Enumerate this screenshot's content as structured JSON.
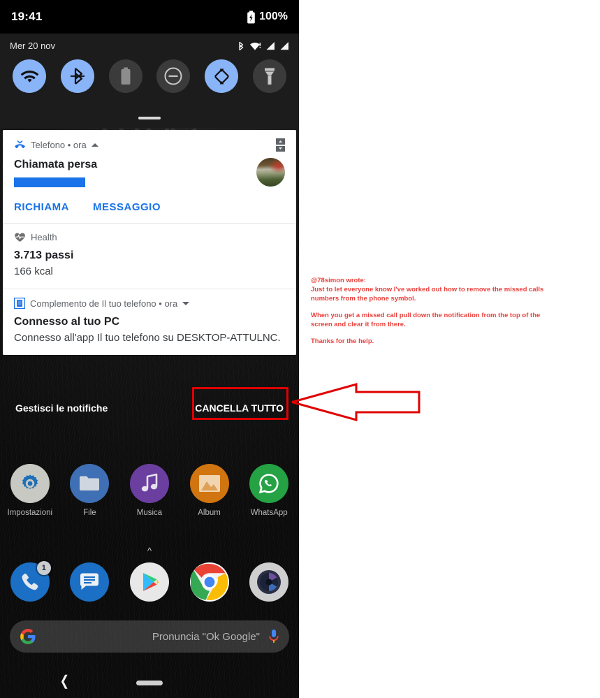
{
  "status_bar": {
    "time": "19:41",
    "battery_percent": "100%",
    "battery_icon": "battery-charging-icon"
  },
  "wallpaper_clock": "19:41",
  "quick_settings": {
    "date": "Mer 20 nov",
    "status_icons": [
      "bluetooth-icon",
      "wifi-icon",
      "signal-bars-icon",
      "signal-bars-2-icon"
    ],
    "tiles": [
      {
        "name": "wifi-tile",
        "icon": "wifi-icon",
        "state": "on"
      },
      {
        "name": "bluetooth-tile",
        "icon": "bluetooth-icon",
        "state": "on"
      },
      {
        "name": "battery-saver-tile",
        "icon": "battery-icon",
        "state": "off"
      },
      {
        "name": "do-not-disturb-tile",
        "icon": "do-not-disturb-icon",
        "state": "off"
      },
      {
        "name": "auto-rotate-tile",
        "icon": "auto-rotate-icon",
        "state": "on"
      },
      {
        "name": "flashlight-tile",
        "icon": "flashlight-icon",
        "state": "off"
      }
    ]
  },
  "notifications": [
    {
      "app": "Telefono • ora",
      "app_icon": "missed-call-icon",
      "expand_state": "expanded",
      "title": "Chiamata persa",
      "redacted_caller": true,
      "avatar": "contact-photo",
      "header_action_icon": "snooze-icon",
      "actions": [
        "RICHIAMA",
        "MESSAGGIO"
      ]
    },
    {
      "app": "Health",
      "app_icon": "heart-icon",
      "title": "3.713 passi",
      "subtitle": "166 kcal"
    },
    {
      "app": "Complemento de Il tuo telefono • ora",
      "app_icon": "your-phone-icon",
      "expand_state": "collapsed",
      "title": "Connesso al tuo PC",
      "subtitle": "Connesso all'app Il tuo telefono su DESKTOP-ATTULNC."
    }
  ],
  "shade_footer": {
    "manage_label": "Gestisci le notifiche",
    "clear_all_label": "CANCELLA TUTTO"
  },
  "home": {
    "apps": [
      {
        "label": "Impostazioni",
        "icon": "settings-gear-icon",
        "color": "#c9c9c4"
      },
      {
        "label": "File",
        "icon": "folder-icon",
        "color": "#3f6fb5"
      },
      {
        "label": "Musica",
        "icon": "music-note-icon",
        "color": "#6b3fa0"
      },
      {
        "label": "Album",
        "icon": "photo-icon",
        "color": "#d0750f"
      },
      {
        "label": "WhatsApp",
        "icon": "whatsapp-icon",
        "color": "#25a244"
      }
    ],
    "drawer_handle_icon": "chevron-up-icon",
    "dock": [
      {
        "name": "phone",
        "icon": "phone-icon",
        "badge": "1",
        "color": "#1b6fc4"
      },
      {
        "name": "messages",
        "icon": "messages-icon",
        "badge": "",
        "color": "#1b6fc4"
      },
      {
        "name": "play-store",
        "icon": "play-store-icon",
        "badge": "",
        "color": "#e8e8e8"
      },
      {
        "name": "chrome",
        "icon": "chrome-icon",
        "badge": "",
        "color": "#ffffff"
      },
      {
        "name": "camera",
        "icon": "camera-icon",
        "badge": "",
        "color": "#cfcfcf"
      }
    ],
    "search": {
      "logo_icon": "google-g-icon",
      "placeholder": "Pronuncia \"Ok Google\"",
      "mic_icon": "microphone-icon"
    },
    "nav": {
      "back_icon": "back-chevron-icon",
      "home_pill_icon": "home-pill-icon"
    }
  },
  "annotation": {
    "quote_header": "@78simon wrote:",
    "paragraph_1": "Just to let everyone know I've worked out how to remove the missed calls numbers from the phone symbol.",
    "paragraph_2": "When you get a missed call pull down the notification from the top of the screen and clear it from there.",
    "paragraph_3": "Thanks for the help.",
    "highlight_color": "#e00000",
    "arrow_icon": "left-arrow-annotation"
  }
}
